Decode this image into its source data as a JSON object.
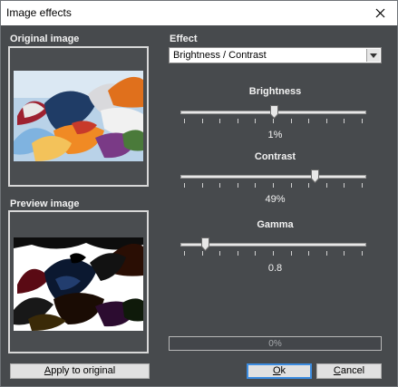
{
  "window": {
    "title": "Image effects",
    "close_icon": "close-icon"
  },
  "original": {
    "label": "Original image"
  },
  "preview": {
    "label": "Preview image"
  },
  "effect": {
    "label": "Effect",
    "selected": "Brightness / Contrast",
    "options": [
      "Brightness / Contrast"
    ]
  },
  "sliders": [
    {
      "name": "Brightness",
      "value_text": "1%",
      "level": 0.5
    },
    {
      "name": "Contrast",
      "value_text": "49%",
      "level": 0.73
    },
    {
      "name": "Gamma",
      "value_text": "0.8",
      "level": 0.11
    }
  ],
  "progress": {
    "text": "0%",
    "fraction": 0
  },
  "buttons": {
    "apply": {
      "accel": "A",
      "rest": "pply to original"
    },
    "ok": {
      "accel": "O",
      "rest": "k"
    },
    "cancel": {
      "accel": "C",
      "rest": "ancel"
    }
  },
  "colors": {
    "background": "#474a4d",
    "titlebar": "#ffffff",
    "accent": "#3c8ce0",
    "text": "#f2f2f2"
  }
}
